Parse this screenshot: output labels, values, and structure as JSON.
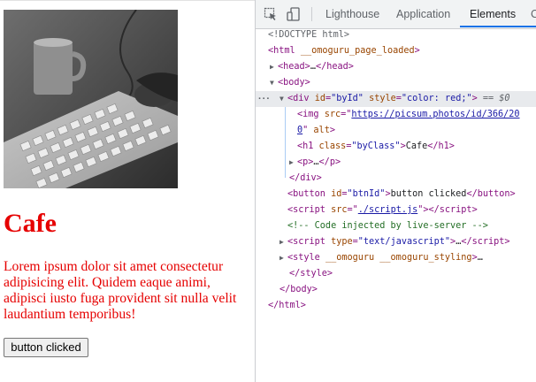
{
  "page": {
    "image_alt": "",
    "heading": "Cafe",
    "paragraph": "Lorem ipsum dolor sit amet consectetur adipisicing elit. Quidem eaque animi, adipisci iusto fuga provident sit nulla velit laudantium temporibus!",
    "button_label": "button clicked",
    "text_color": "#e60000"
  },
  "devtools": {
    "tabs": [
      {
        "label": "Lighthouse",
        "active": false
      },
      {
        "label": "Application",
        "active": false
      },
      {
        "label": "Elements",
        "active": true
      },
      {
        "label": "C",
        "active": false
      }
    ],
    "toolbar_icons": [
      "inspect-element-icon",
      "device-toolbar-icon"
    ],
    "accent_color": "#1a73e8",
    "tree": {
      "doctype": "<!DOCTYPE html>",
      "html_attr": "__omoguru_page_loaded",
      "head_tag": "<head>",
      "head_ellipsis": "…",
      "head_close": "</head>",
      "body_open": "<body>",
      "div_open": "<div",
      "div_id_attr": "id",
      "div_id_val": "\"byId\"",
      "div_style_attr": "style",
      "div_style_val": "\"color: red;\"",
      "div_marker": "== $0",
      "img_tag": "<img",
      "img_src_attr": "src",
      "img_src_line1": "https://picsum.photos/id/366/20",
      "img_src_line2": "0",
      "img_alt_attr": "alt",
      "h1_class_attr": "class",
      "h1_class_val": "\"byClass\"",
      "h1_text": "Cafe",
      "p_text": "…",
      "button_id_attr": "id",
      "button_id_val": "\"btnId\"",
      "button_text": "button clicked",
      "script_src_attr": "src",
      "script_src_val": "./script.js",
      "comment": "<!-- Code injected by live-server -->",
      "script2_type_attr": "type",
      "script2_type_val": "\"text/javascript\"",
      "style_attrs": "__omoguru __omoguru_styling",
      "ellipsis_more": "…"
    }
  }
}
